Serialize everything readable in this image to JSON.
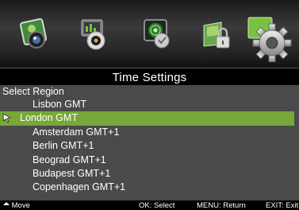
{
  "menu": {
    "icons": [
      "photo-icon",
      "media-icon",
      "channel-icon",
      "lock-icon",
      "gear-icon"
    ],
    "active_index": 4
  },
  "title": "Time Settings",
  "subtitle": "Select Region",
  "regions": [
    "Lisbon GMT",
    "London GMT",
    "Amsterdam GMT+1",
    "Berlin GMT+1",
    "Beograd GMT+1",
    "Budapest GMT+1",
    "Copenhagen GMT+1"
  ],
  "selected_region": "London GMT",
  "hints": {
    "move": "Move",
    "ok": "OK: Select",
    "menu": "MENU: Return",
    "exit": "EXIT: Exit"
  },
  "colors": {
    "highlight": "#78a73a",
    "panel": "#4a4a4a"
  }
}
